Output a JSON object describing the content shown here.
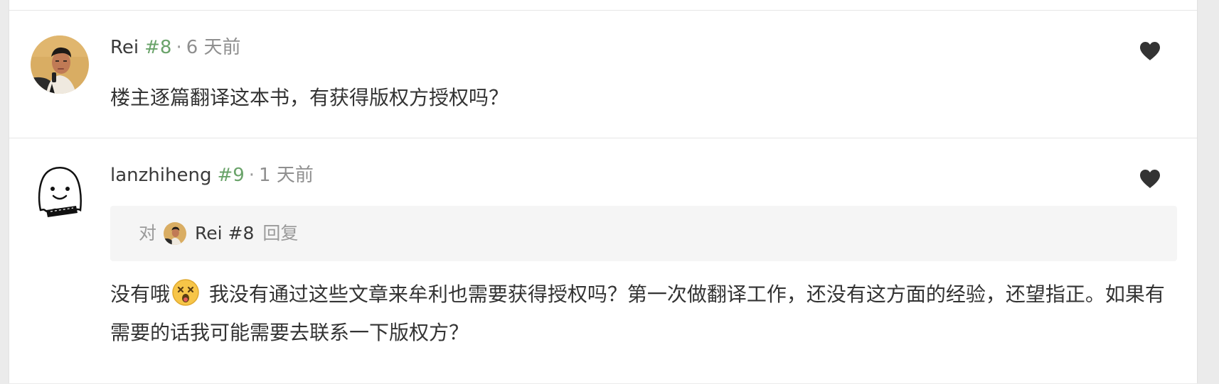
{
  "colors": {
    "page_background": "#ebebeb",
    "panel_background": "#ffffff",
    "floor_link": "#6aa36a",
    "meta_text": "#8f8f8f",
    "reply_box": "#f5f5f5",
    "heart": "#333333"
  },
  "posts": [
    {
      "author": "Rei",
      "floor": "#8",
      "separator": "·",
      "time": "6 天前",
      "avatar_icon": "man-photo-avatar",
      "like_icon": "heart-icon",
      "content": "楼主逐篇翻译这本书，有获得版权方授权吗？"
    },
    {
      "author": "lanzhiheng",
      "floor": "#9",
      "separator": "·",
      "time": "1 天前",
      "avatar_icon": "ghost-cartoon-avatar",
      "like_icon": "heart-icon",
      "reply_to": {
        "prefix": "对",
        "target": "Rei #8",
        "suffix": "回复",
        "avatar_icon": "man-photo-avatar"
      },
      "content_before_emoji": "没有哦",
      "emoji_icon": "dizzy-face-emoji",
      "content_after_emoji": " 我没有通过这些文章来牟利也需要获得授权吗？第一次做翻译工作，还没有这方面的经验，还望指正。如果有需要的话我可能需要去联系一下版权方？"
    }
  ]
}
